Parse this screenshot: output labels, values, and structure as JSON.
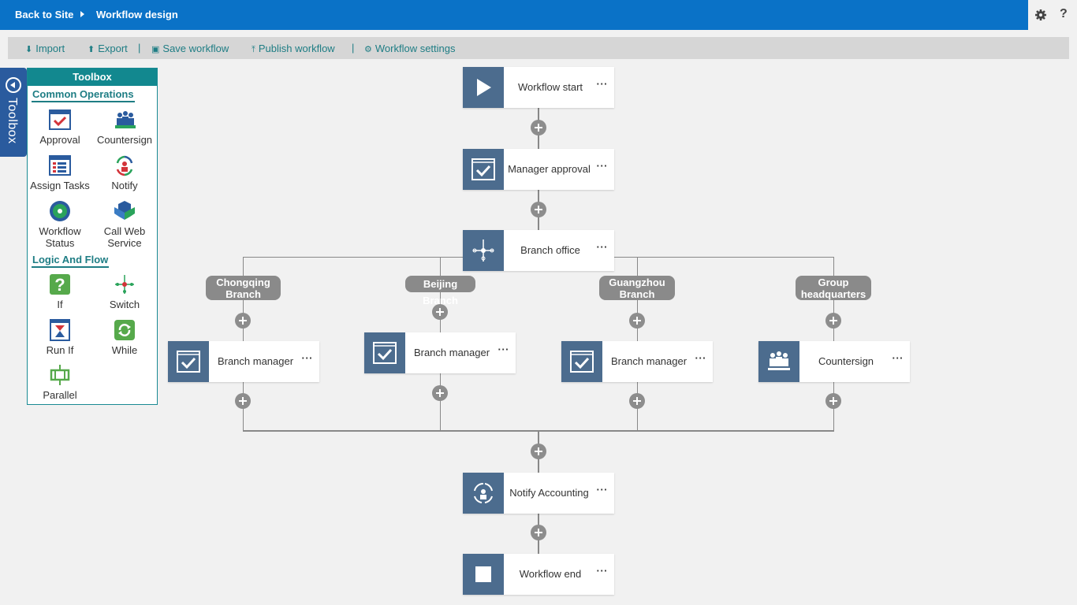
{
  "topbar": {
    "back_label": "Back to Site",
    "title": "Workflow design",
    "settings_icon": "gear-icon",
    "help_label": "?"
  },
  "toolbar": {
    "import": "Import",
    "export": "Export",
    "save": "Save workflow",
    "publish": "Publish workflow",
    "settings": "Workflow settings",
    "sep": "|"
  },
  "toolbox": {
    "tab_label": "Toolbox",
    "title": "Toolbox",
    "common_title": "Common Operations",
    "logic_title": "Logic And Flow",
    "tools": {
      "approval": "Approval",
      "countersign": "Countersign",
      "assign_tasks": "Assign Tasks",
      "notify": "Notify",
      "workflow_status_1": "Workflow",
      "workflow_status_2": "Status",
      "call_web_1": "Call Web",
      "call_web_2": "Service",
      "if": "If",
      "switch": "Switch",
      "run_if": "Run If",
      "while": "While",
      "parallel": "Parallel"
    }
  },
  "workflow": {
    "nodes": {
      "start": "Workflow start",
      "manager_approval": "Manager approval",
      "branch_office": "Branch office",
      "chongqing_manager": "Branch manager",
      "beijing_manager": "Branch manager",
      "guangzhou_manager": "Branch manager",
      "countersign": "Countersign",
      "notify_accounting": "Notify Accounting",
      "end": "Workflow end"
    },
    "more_label": "···",
    "branches": {
      "chongqing_1": "Chongqing",
      "chongqing_2": "Branch",
      "beijing": "Beijing Branch",
      "guangzhou_1": "Guangzhou",
      "guangzhou_2": "Branch",
      "group_1": "Group",
      "group_2": "headquarters"
    }
  },
  "colors": {
    "topbar": "#0a72c7",
    "teal": "#12888f",
    "node_icon": "#4c6c8e",
    "connector": "#888888"
  }
}
